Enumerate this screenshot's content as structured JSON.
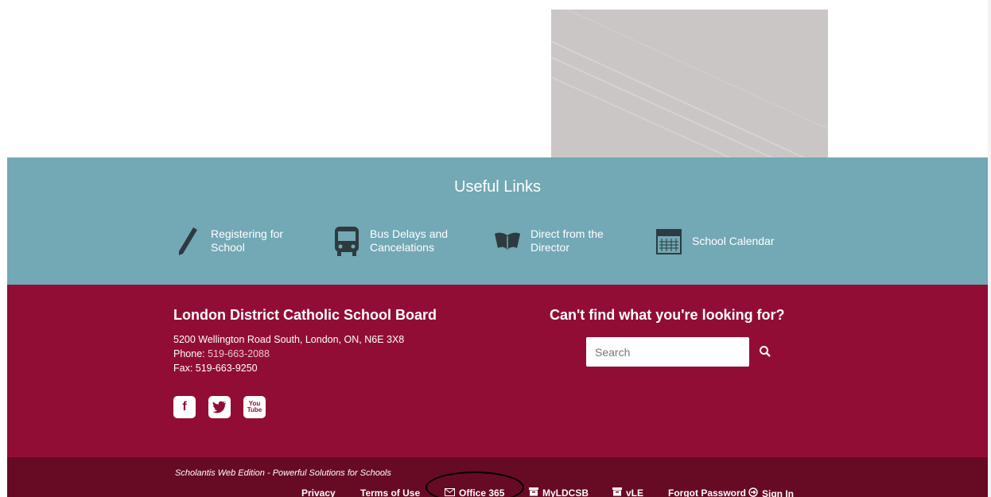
{
  "useful_links": {
    "title": "Useful Links",
    "items": [
      {
        "label": "Registering for School",
        "icon": "pencil-icon"
      },
      {
        "label": "Bus Delays and Cancelations",
        "icon": "bus-icon"
      },
      {
        "label": "Direct from the Director",
        "icon": "open-book-icon"
      },
      {
        "label": "School Calendar",
        "icon": "calendar-icon"
      }
    ]
  },
  "board": {
    "name": "London District Catholic School Board",
    "address": "5200 Wellington Road South, London, ON, N6E 3X8",
    "phone_label": "Phone:",
    "phone": "519-663-2088",
    "fax": "Fax: 519-663-9250",
    "social": [
      {
        "name": "facebook-icon",
        "glyph": "f"
      },
      {
        "name": "twitter-icon",
        "glyph": "t"
      },
      {
        "name": "youtube-icon",
        "glyph": "You Tube"
      }
    ]
  },
  "search": {
    "heading": "Can't find what you're looking for?",
    "placeholder": "Search",
    "value": ""
  },
  "footer": {
    "powered": "Scholantis Web Edition - Powerful Solutions for Schools",
    "links": {
      "privacy": "Privacy",
      "terms": "Terms of Use",
      "office": "Office 365",
      "myldcsb": "MyLDCSB",
      "vle": "vLE",
      "forgot": "Forgot Password",
      "signin": "Sign In"
    }
  },
  "colors": {
    "teal": "#73a8b5",
    "crimson": "#920d35",
    "dark_crimson": "#670a24"
  }
}
